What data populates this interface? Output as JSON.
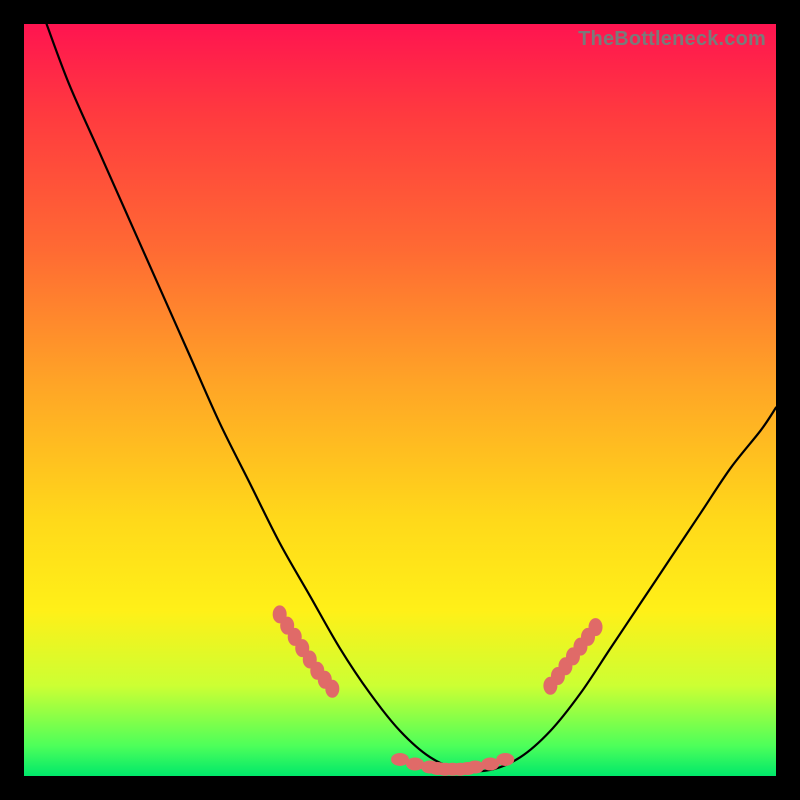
{
  "watermark": "TheBottleneck.com",
  "colors": {
    "background": "#000000",
    "curve_stroke": "#000000",
    "marker_fill": "#e06a68",
    "gradient_stops": [
      "#ff1450",
      "#ff6a33",
      "#ffd91a",
      "#ccff33",
      "#00e86a"
    ]
  },
  "chart_data": {
    "type": "line",
    "title": "",
    "xlabel": "",
    "ylabel": "",
    "xlim": [
      0,
      100
    ],
    "ylim": [
      0,
      100
    ],
    "grid": false,
    "legend": null,
    "series": [
      {
        "name": "bottleneck-curve",
        "x": [
          3,
          6,
          10,
          14,
          18,
          22,
          26,
          30,
          34,
          38,
          42,
          46,
          50,
          54,
          58,
          62,
          66,
          70,
          74,
          78,
          82,
          86,
          90,
          94,
          98,
          100
        ],
        "y": [
          100,
          92,
          83,
          74,
          65,
          56,
          47,
          39,
          31,
          24,
          17,
          11,
          6,
          2.5,
          0.8,
          0.8,
          2.5,
          6,
          11,
          17,
          23,
          29,
          35,
          41,
          46,
          49
        ]
      }
    ],
    "markers": {
      "name": "highlighted-region",
      "series_ref": "bottleneck-curve",
      "left_cluster": {
        "x": [
          34,
          35,
          36,
          37,
          38,
          39,
          40,
          41
        ],
        "y": [
          21.5,
          20,
          18.5,
          17,
          15.5,
          14,
          12.8,
          11.6
        ]
      },
      "bottom_cluster": {
        "x": [
          50,
          52,
          54,
          55,
          56,
          57,
          58,
          59,
          60,
          62,
          64
        ],
        "y": [
          2.2,
          1.6,
          1.2,
          1.0,
          0.9,
          0.9,
          0.9,
          1.0,
          1.2,
          1.6,
          2.2
        ]
      },
      "right_cluster": {
        "x": [
          70,
          71,
          72,
          73,
          74,
          75,
          76
        ],
        "y": [
          12.0,
          13.3,
          14.6,
          15.9,
          17.2,
          18.5,
          19.8
        ]
      }
    }
  }
}
